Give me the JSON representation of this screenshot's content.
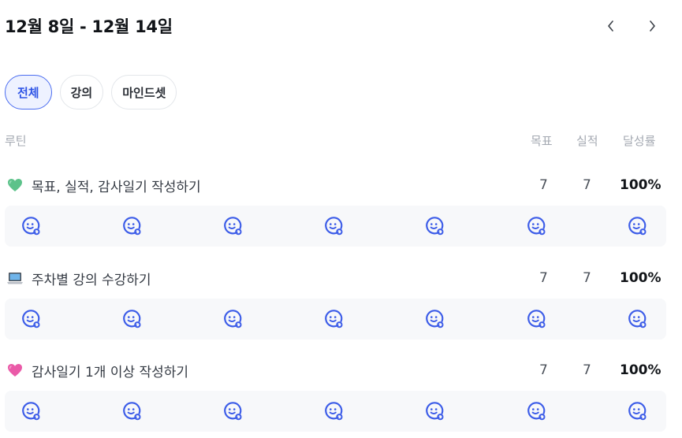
{
  "header": {
    "week_title": "12월 8일 - 12월 14일"
  },
  "filters": [
    {
      "label": "전체",
      "active": true
    },
    {
      "label": "강의",
      "active": false
    },
    {
      "label": "마인드셋",
      "active": false
    }
  ],
  "columns": {
    "routine": "루틴",
    "goal": "목표",
    "performance": "실적",
    "rate": "달성률"
  },
  "routines": [
    {
      "icon": "green-heart-icon",
      "title": "목표, 실적, 감사일기 작성하기",
      "goal": "7",
      "performance": "7",
      "rate": "100%"
    },
    {
      "icon": "laptop-icon",
      "title": "주차별 강의 수강하기",
      "goal": "7",
      "performance": "7",
      "rate": "100%"
    },
    {
      "icon": "pink-heart-icon",
      "title": "감사일기 1개 이상 작성하기",
      "goal": "7",
      "performance": "7",
      "rate": "100%"
    }
  ],
  "colors": {
    "accent": "#2f55e6",
    "face_icon": "#3d5de8",
    "strip_bg": "#f7f8fa"
  }
}
